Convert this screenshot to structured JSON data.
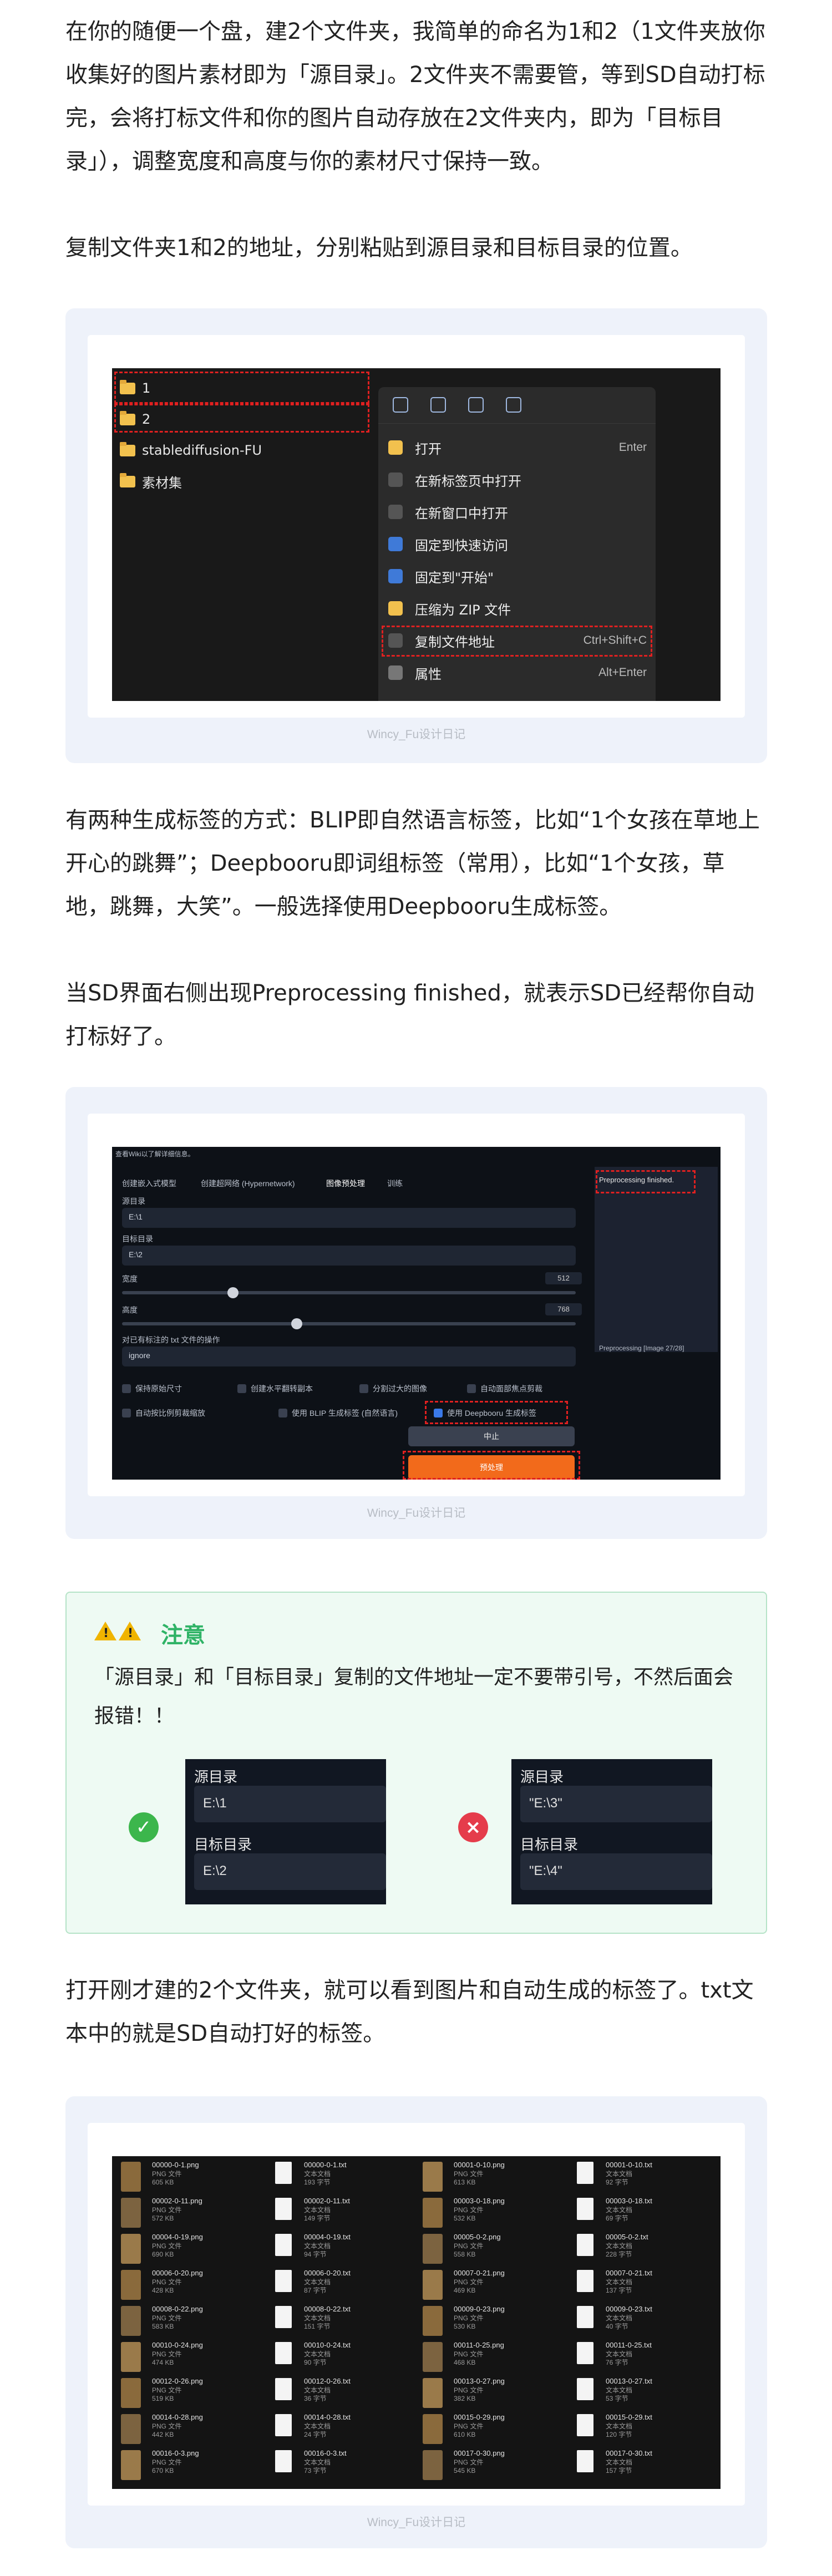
{
  "para1": "在你的随便一个盘，建2个文件夹，我简单的命名为1和2（1文件夹放你收集好的图片素材即为「源目录」。2文件夹不需要管，等到SD自动打标完，会将打标文件和你的图片自动存放在2文件夹内，即为「目标目录」），调整宽度和高度与你的素材尺寸保持一致。",
  "para2": "复制文件夹1和2的地址，分别粘贴到源目录和目标目录的位置。",
  "para3": "有两种生成标签的方式：BLIP即自然语言标签，比如“1个女孩在草地上开心的跳舞”；Deepbooru即词组标签（常用），比如“1个女孩，草地，跳舞，大笑”。一般选择使用Deepbooru生成标签。",
  "para4": "当SD界面右侧出现Preprocessing finished，就表示SD已经帮你自动打标好了。",
  "para5": "打开刚才建的2个文件夹，就可以看到图片和自动生成的标签了。txt文本中的就是SD自动打好的标签。",
  "caption": "Wincy_Fu设计日记",
  "explorer": {
    "folders": [
      "1",
      "2",
      "stablediffusion-FU",
      "素材集"
    ],
    "menu": [
      {
        "label": "打开",
        "shortcut": "Enter"
      },
      {
        "label": "在新标签页中打开",
        "shortcut": ""
      },
      {
        "label": "在新窗口中打开",
        "shortcut": ""
      },
      {
        "label": "固定到快速访问",
        "shortcut": ""
      },
      {
        "label": "固定到\"开始\"",
        "shortcut": ""
      },
      {
        "label": "压缩为 ZIP 文件",
        "shortcut": ""
      },
      {
        "label": "复制文件地址",
        "shortcut": "Ctrl+Shift+C"
      },
      {
        "label": "属性",
        "shortcut": "Alt+Enter"
      }
    ]
  },
  "sd": {
    "top_note": "查看Wiki以了解详细信息。",
    "tabs": [
      "创建嵌入式模型",
      "创建超网络 (Hypernetwork)",
      "图像预处理",
      "训练"
    ],
    "source_label": "源目录",
    "source_value": "E:\\1",
    "target_label": "目标目录",
    "target_value": "E:\\2",
    "width_label": "宽度",
    "width_value": "512",
    "height_label": "高度",
    "height_value": "768",
    "txt_label": "对已有标注的 txt 文件的操作",
    "txt_value": "ignore",
    "checks_row1": [
      "保持原始尺寸",
      "创建水平翻转副本",
      "分割过大的图像",
      "自动面部焦点剪裁"
    ],
    "checks_row2": [
      "自动按比例剪裁缩放",
      "使用 BLIP 生成标签 (自然语言)",
      "使用 Deepbooru 生成标签"
    ],
    "interrupt": "中止",
    "preprocess": "预处理",
    "finished": "Preprocessing finished.",
    "progress": "Preprocessing [Image 27/28]"
  },
  "notice": {
    "title": "注意",
    "body": "「源目录」和「目标目录」复制的文件地址一定不要带引号，不然后面会报错！！",
    "good": {
      "source_label": "源目录",
      "source_value": "E:\\1",
      "target_label": "目标目录",
      "target_value": "E:\\2"
    },
    "bad": {
      "source_label": "源目录",
      "source_value": "\"E:\\3\"",
      "target_label": "目标目录",
      "target_value": "\"E:\\4\""
    }
  },
  "files": [
    {
      "name": "00000-0-1.png",
      "type": "PNG 文件",
      "size": "605 KB"
    },
    {
      "name": "00000-0-1.txt",
      "type": "文本文档",
      "size": "193 字节"
    },
    {
      "name": "00001-0-10.png",
      "type": "PNG 文件",
      "size": "613 KB"
    },
    {
      "name": "00001-0-10.txt",
      "type": "文本文档",
      "size": "92 字节"
    },
    {
      "name": "00002-0-11.png",
      "type": "PNG 文件",
      "size": "572 KB"
    },
    {
      "name": "00002-0-11.txt",
      "type": "文本文档",
      "size": "149 字节"
    },
    {
      "name": "00003-0-18.png",
      "type": "PNG 文件",
      "size": "532 KB"
    },
    {
      "name": "00003-0-18.txt",
      "type": "文本文档",
      "size": "69 字节"
    },
    {
      "name": "00004-0-19.png",
      "type": "PNG 文件",
      "size": "690 KB"
    },
    {
      "name": "00004-0-19.txt",
      "type": "文本文档",
      "size": "94 字节"
    },
    {
      "name": "00005-0-2.png",
      "type": "PNG 文件",
      "size": "558 KB"
    },
    {
      "name": "00005-0-2.txt",
      "type": "文本文档",
      "size": "228 字节"
    },
    {
      "name": "00006-0-20.png",
      "type": "PNG 文件",
      "size": "428 KB"
    },
    {
      "name": "00006-0-20.txt",
      "type": "文本文档",
      "size": "87 字节"
    },
    {
      "name": "00007-0-21.png",
      "type": "PNG 文件",
      "size": "469 KB"
    },
    {
      "name": "00007-0-21.txt",
      "type": "文本文档",
      "size": "137 字节"
    },
    {
      "name": "00008-0-22.png",
      "type": "PNG 文件",
      "size": "583 KB"
    },
    {
      "name": "00008-0-22.txt",
      "type": "文本文档",
      "size": "151 字节"
    },
    {
      "name": "00009-0-23.png",
      "type": "PNG 文件",
      "size": "530 KB"
    },
    {
      "name": "00009-0-23.txt",
      "type": "文本文档",
      "size": "40 字节"
    },
    {
      "name": "00010-0-24.png",
      "type": "PNG 文件",
      "size": "474 KB"
    },
    {
      "name": "00010-0-24.txt",
      "type": "文本文档",
      "size": "90 字节"
    },
    {
      "name": "00011-0-25.png",
      "type": "PNG 文件",
      "size": "468 KB"
    },
    {
      "name": "00011-0-25.txt",
      "type": "文本文档",
      "size": "76 字节"
    },
    {
      "name": "00012-0-26.png",
      "type": "PNG 文件",
      "size": "519 KB"
    },
    {
      "name": "00012-0-26.txt",
      "type": "文本文档",
      "size": "36 字节"
    },
    {
      "name": "00013-0-27.png",
      "type": "PNG 文件",
      "size": "382 KB"
    },
    {
      "name": "00013-0-27.txt",
      "type": "文本文档",
      "size": "53 字节"
    },
    {
      "name": "00014-0-28.png",
      "type": "PNG 文件",
      "size": "442 KB"
    },
    {
      "name": "00014-0-28.txt",
      "type": "文本文档",
      "size": "24 字节"
    },
    {
      "name": "00015-0-29.png",
      "type": "PNG 文件",
      "size": "610 KB"
    },
    {
      "name": "00015-0-29.txt",
      "type": "文本文档",
      "size": "120 字节"
    },
    {
      "name": "00016-0-3.png",
      "type": "PNG 文件",
      "size": "670 KB"
    },
    {
      "name": "00016-0-3.txt",
      "type": "文本文档",
      "size": "73 字节"
    },
    {
      "name": "00017-0-30.png",
      "type": "PNG 文件",
      "size": "545 KB"
    },
    {
      "name": "00017-0-30.txt",
      "type": "文本文档",
      "size": "157 字节"
    }
  ]
}
